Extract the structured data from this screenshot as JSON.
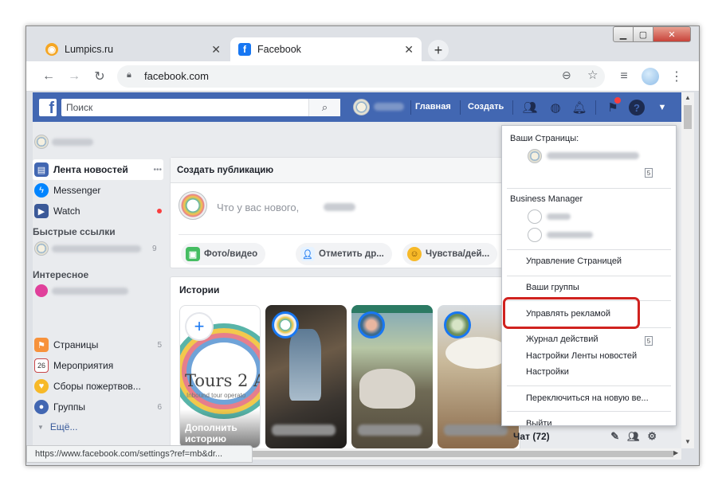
{
  "browser": {
    "tabs": [
      {
        "title": "Lumpics.ru",
        "icon": "lumpics-icon",
        "active": false
      },
      {
        "title": "Facebook",
        "icon": "facebook-icon",
        "active": true
      }
    ],
    "new_tab_label": "+",
    "url": "facebook.com",
    "status_url": "https://www.facebook.com/settings?ref=mb&dr..."
  },
  "fb_header": {
    "logo": "f",
    "search_placeholder": "Поиск",
    "home_label": "Главная",
    "create_label": "Создать"
  },
  "sidebar": {
    "items": [
      {
        "label": "Лента новостей",
        "count": "",
        "icon": "news-feed-icon",
        "more": "•••"
      },
      {
        "label": "Messenger",
        "count": "",
        "icon": "messenger-icon"
      },
      {
        "label": "Watch",
        "count": "",
        "icon": "watch-icon"
      }
    ],
    "quick_links_title": "Быстрые ссылки",
    "quick_link_count": "9",
    "interesting_title": "Интересное",
    "interesting_items": [
      {
        "label": "Страницы",
        "count": "5",
        "icon": "pages-flag-icon"
      },
      {
        "label": "Мероприятия",
        "count": "",
        "icon": "calendar-icon"
      },
      {
        "label": "Сборы пожертвов...",
        "count": "",
        "icon": "fundraiser-icon"
      },
      {
        "label": "Группы",
        "count": "6",
        "icon": "groups-icon"
      }
    ],
    "more_label": "Ещё..."
  },
  "composer": {
    "header": "Создать публикацию",
    "placeholder": "Что у вас нового,",
    "chips": [
      {
        "label": "Фото/видео",
        "icon": "photo-icon"
      },
      {
        "label": "Отметить др...",
        "icon": "tag-friends-icon"
      },
      {
        "label": "Чувства/дей...",
        "icon": "feeling-icon"
      }
    ],
    "more_chip": "•••"
  },
  "stories": {
    "title": "Истории",
    "add_label": "Дополнить историю",
    "first_story_text": "Tours 2 Ar",
    "first_story_subtext": "Inbound tour operato"
  },
  "dropdown": {
    "pages_title": "Ваши Страницы:",
    "pages_badge": "5",
    "bm_title": "Business Manager",
    "items": [
      "Управление Страницей",
      "Ваши группы",
      "Управлять рекламой",
      "Журнал действий",
      "Настройки Ленты новостей",
      "Настройки",
      "Переключиться на новую ве...",
      "Выйти"
    ],
    "journal_badge": "5",
    "highlight_color": "#d0221f"
  },
  "chat": {
    "label": "Чат (72)"
  },
  "colors": {
    "fb_blue": "#4267b2",
    "page_bg": "#e9ebee",
    "chrome_bg": "#dee1e6"
  }
}
